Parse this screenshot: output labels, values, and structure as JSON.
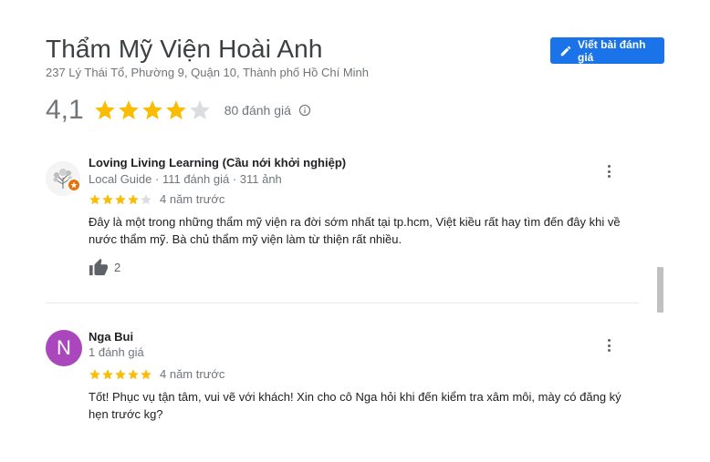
{
  "place": {
    "title": "Thẩm Mỹ Viện Hoài Anh",
    "address": "237 Lý Thái Tổ, Phường 9, Quận 10, Thành phố Hồ Chí Minh",
    "write_review_label": "Viết bài đánh giá",
    "rating": "4,1",
    "rating_value": 4.1,
    "review_count_label": "80 đánh giá"
  },
  "colors": {
    "star_filled": "#fbbc04",
    "star_empty": "#dadce0",
    "accent": "#1a73e8",
    "avatar_n": "#ab47bc",
    "guide_badge": "#e8710a"
  },
  "reviews": [
    {
      "author": "Loving Living Learning (Cầu nới khởi nghiệp)",
      "guide_label": "Local Guide",
      "stats": "· 111 đánh giá · 311 ảnh",
      "stars": 4,
      "date": "4 năm trước",
      "text": "Đây là một trong những thẩm mỹ viện ra đời sớm nhất tại tp.hcm, Việt kiều rất hay tìm đến đây khi về nước thẩm mỹ. Bà chủ thẩm mỹ viện làm từ thiện rất nhiều.",
      "likes": "2",
      "avatar": "photo-avatar"
    },
    {
      "author": "Nga Bui",
      "initial": "N",
      "stats": "1 đánh giá",
      "stars": 5,
      "date": "4 năm trước",
      "text": "Tốt! Phục vụ tận tâm,  vui vẽ với khách! Xin cho cô Nga hỏi khi đến kiểm tra xâm môi, mày có đăng ký hẹn trước kg?"
    }
  ]
}
